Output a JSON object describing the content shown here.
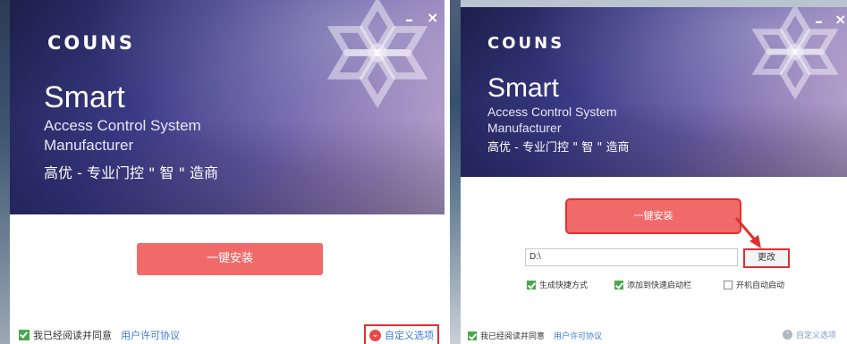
{
  "colors": {
    "accent_button": "#f06a6a",
    "highlight_box": "#e03030",
    "link": "#3b7ad9",
    "checkbox_checked": "#4aa84a"
  },
  "left_window": {
    "window_controls": {
      "minimize": "–",
      "close": "×"
    },
    "logo": "COUNS",
    "brand": {
      "title": "Smart",
      "line1": "Access Control System",
      "line2": "Manufacturer",
      "slogan": "高优 - 专业门控 \" 智 \" 造商"
    },
    "install_button": "一键安装",
    "footer": {
      "agree_checked": true,
      "agree_text": "我已经阅读并同意",
      "license_link": "用户许可协议",
      "custom_options": "自定义选项",
      "custom_icon": "chevron-down-icon"
    }
  },
  "right_window": {
    "window_controls": {
      "minimize": "–",
      "close": "×"
    },
    "logo": "COUNS",
    "brand": {
      "title": "Smart",
      "line1": "Access Control System",
      "line2": "Manufacturer",
      "slogan": "高优 - 专业门控 \" 智 \" 造商"
    },
    "install_button": "一键安装",
    "install_path": "D:\\",
    "change_button": "更改",
    "options": [
      {
        "label": "生成快捷方式",
        "checked": true
      },
      {
        "label": "添加到快速启动栏",
        "checked": true
      },
      {
        "label": "开机自动启动",
        "checked": false
      }
    ],
    "footer": {
      "agree_checked": true,
      "agree_text": "我已经阅读并同意",
      "license_link": "用户许可协议",
      "custom_options": "自定义选项",
      "custom_icon": "chevron-up-icon"
    }
  }
}
